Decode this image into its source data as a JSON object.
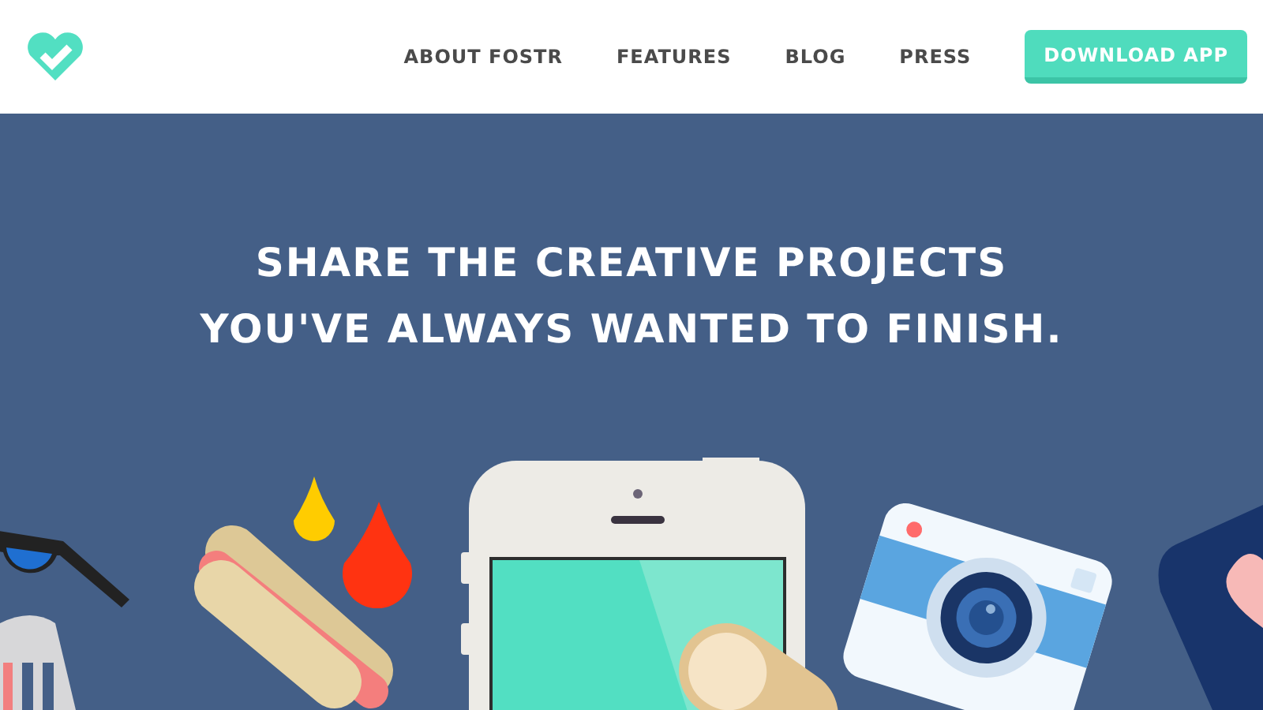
{
  "header": {
    "nav": [
      {
        "label": "ABOUT FOSTR"
      },
      {
        "label": "FEATURES"
      },
      {
        "label": "BLOG"
      },
      {
        "label": "PRESS"
      }
    ],
    "cta": {
      "label": "DOWNLOAD APP"
    }
  },
  "hero": {
    "headline": [
      "SHARE THE CREATIVE PROJECTS",
      "YOU'VE ALWAYS WANTED TO FINISH."
    ]
  }
}
